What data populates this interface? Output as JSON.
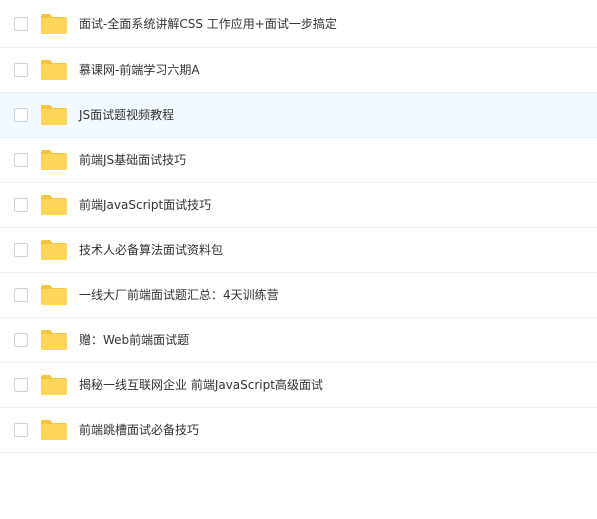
{
  "colors": {
    "folder_body": "#FFD659",
    "folder_tab": "#F5C542",
    "row_highlight": "#F3FAFF",
    "text": "#333333"
  },
  "file_list": {
    "items": [
      {
        "name": "面试-全面系统讲解CSS 工作应用+面试一步搞定",
        "icon": "folder-icon",
        "checked": false
      },
      {
        "name": "慕课网-前端学习六期A",
        "icon": "folder-icon",
        "checked": false
      },
      {
        "name": "JS面试题视频教程",
        "icon": "folder-icon",
        "checked": false
      },
      {
        "name": "前端JS基础面试技巧",
        "icon": "folder-icon",
        "checked": false
      },
      {
        "name": "前端JavaScript面试技巧",
        "icon": "folder-icon",
        "checked": false
      },
      {
        "name": "技术人必备算法面试资料包",
        "icon": "folder-icon",
        "checked": false
      },
      {
        "name": "一线大厂前端面试题汇总：4天训练营",
        "icon": "folder-icon",
        "checked": false
      },
      {
        "name": "赠：Web前端面试题",
        "icon": "folder-icon",
        "checked": false
      },
      {
        "name": "揭秘一线互联网企业 前端JavaScript高级面试",
        "icon": "folder-icon",
        "checked": false
      },
      {
        "name": "前端跳槽面试必备技巧",
        "icon": "folder-icon",
        "checked": false
      }
    ]
  }
}
